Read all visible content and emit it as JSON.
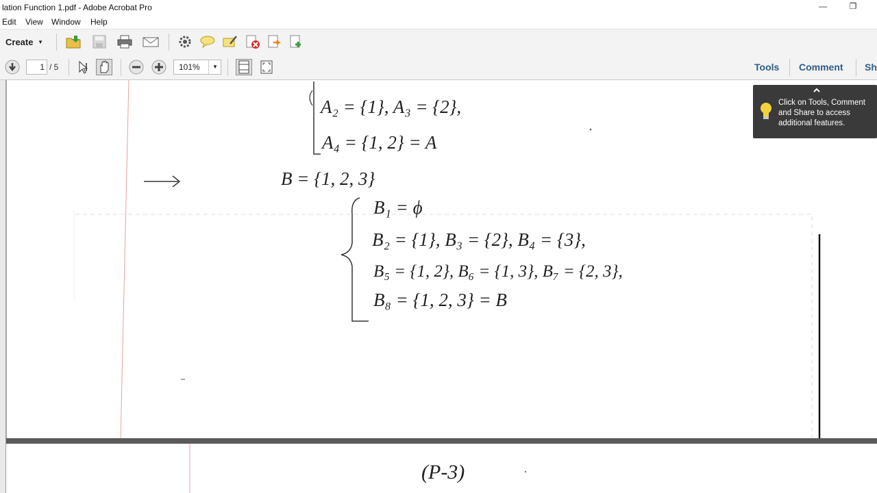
{
  "window": {
    "title": "lation Function 1.pdf - Adobe Acrobat Pro",
    "minimize_glyph": "—",
    "restore_glyph": "❐"
  },
  "menu": [
    "Edit",
    "View",
    "Window",
    "Help"
  ],
  "toolbar": {
    "create_label": "Create",
    "icons": [
      "open-folder-icon",
      "save-icon",
      "print-icon",
      "email-icon",
      "gear-icon",
      "comment-icon",
      "sign-icon",
      "delete-icon",
      "export-icon",
      "share-icon"
    ]
  },
  "navigation": {
    "page_current": "1",
    "page_total": "/ 5",
    "zoom_value": "101%"
  },
  "panels": {
    "tools": "Tools",
    "comment": "Comment",
    "share": "Sh"
  },
  "tooltip": {
    "text": "Click on Tools, Comment and Share to access additional features."
  },
  "document": {
    "lines": {
      "a2_a3": "A₂ = {1}, A₃ = {2},",
      "a4": "A₄ = {1, 2} = A",
      "b_set": "B = {1, 2, 3}",
      "b1": "B₁ = ϕ",
      "b2_b4": "B₂ = {1}, B₃ = {2}, B₄ = {3},",
      "b5_b7": "B₅ = {1, 2}, B₆ = {1, 3}, B₇ = {2, 3},",
      "b8": "B₈ = {1, 2, 3} = B",
      "page_label": "(P-3)"
    }
  },
  "colors": {
    "panel_link": "#2f5b85",
    "tooltip_bg": "#3a3a3a",
    "margin_line": "#e8a0a0"
  }
}
